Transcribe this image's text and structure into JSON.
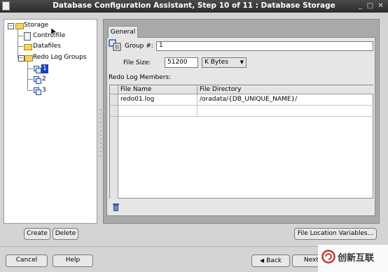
{
  "window": {
    "title": "Database Configuration Assistant, Step 10 of 11 : Database Storage"
  },
  "tree": {
    "root": "Storage",
    "controlfile": "Controlfile",
    "datafiles": "Datafiles",
    "redo_groups": "Redo Log Groups",
    "groups": [
      "1",
      "2",
      "3"
    ],
    "selected": "1"
  },
  "tab": {
    "label": "General"
  },
  "form": {
    "group_label": "Group #:",
    "group_value": "1",
    "filesize_label": "File Size:",
    "filesize_value": "51200",
    "unit_value": "K Bytes",
    "members_label": "Redo Log Members:"
  },
  "table": {
    "columns": [
      "File Name",
      "File Directory"
    ],
    "rows": [
      [
        "redo01.log",
        "/oradata/{DB_UNIQUE_NAME}/"
      ],
      [
        "",
        ""
      ]
    ]
  },
  "buttons": {
    "create": "Create",
    "delete": "Delete",
    "file_location": "File Location Variables...",
    "cancel": "Cancel",
    "help": "Help",
    "back": "Back",
    "next": "Next"
  },
  "watermark": {
    "text": "创新互联"
  }
}
